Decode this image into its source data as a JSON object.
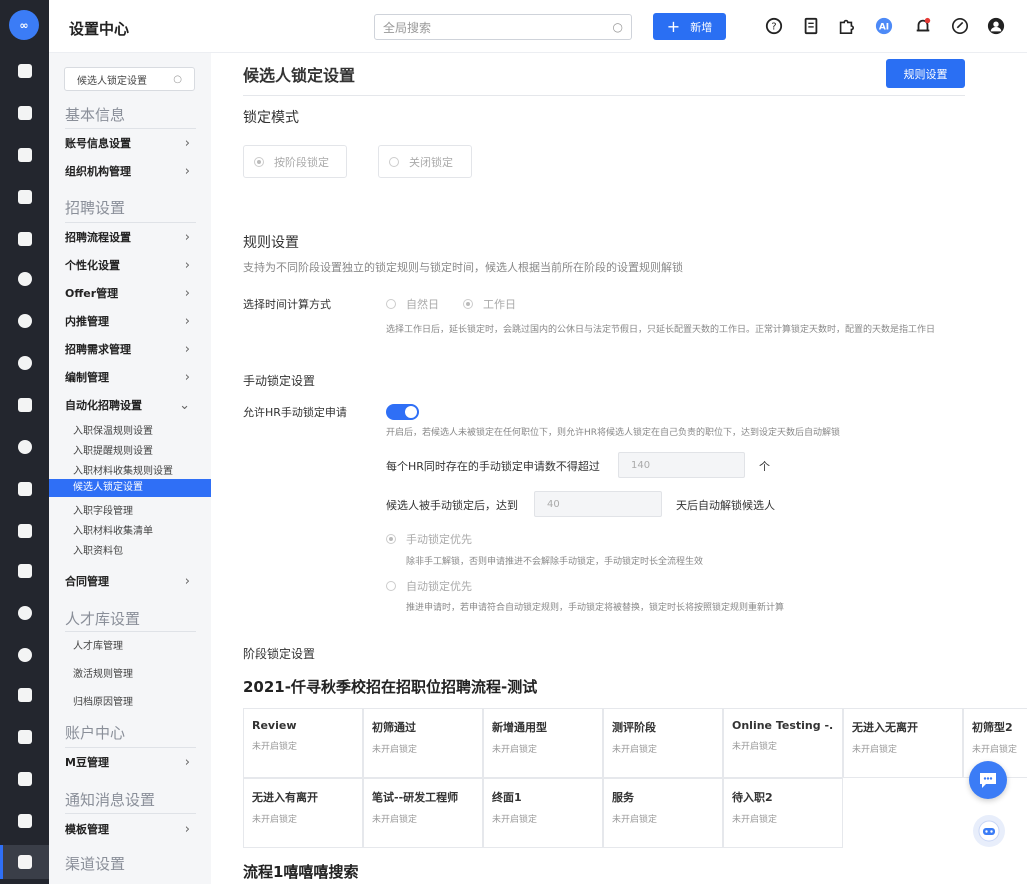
{
  "header": {
    "title": "设置中心",
    "search_placeholder": "全局搜索",
    "add_label": "新增",
    "ai_label": "AI"
  },
  "menu": {
    "search_value": "候选人锁定设置",
    "sections": [
      {
        "title": "基本信息",
        "items": [
          "账号信息设置",
          "组织机构管理"
        ]
      },
      {
        "title": "招聘设置",
        "items": [
          "招聘流程设置",
          "个性化设置",
          "Offer管理",
          "内推管理",
          "招聘需求管理",
          "编制管理",
          "自动化招聘设置"
        ]
      },
      {
        "title": "人才库设置"
      },
      {
        "title": "账户中心",
        "items": [
          "M豆管理"
        ]
      },
      {
        "title": "通知消息设置",
        "items": [
          "模板管理"
        ]
      },
      {
        "title": "渠道设置"
      }
    ],
    "auto_subitems": [
      "入职保温规则设置",
      "入职提醒规则设置",
      "入职材料收集规则设置",
      "候选人锁定设置",
      "入职字段管理",
      "入职材料收集清单",
      "入职资料包"
    ],
    "contract_label": "合同管理",
    "talent_subitems": [
      "人才库管理",
      "激活规则管理",
      "归档原因管理"
    ]
  },
  "main": {
    "page_title": "候选人锁定设置",
    "rule_button": "规则设置",
    "lock_mode": {
      "heading": "锁定模式",
      "options": [
        "按阶段锁定",
        "关闭锁定"
      ]
    },
    "rules": {
      "heading": "规则设置",
      "description": "支持为不同阶段设置独立的锁定规则与锁定时间，候选人根据当前所在阶段的设置规则解锁",
      "time_method_label": "选择时间计算方式",
      "time_options": [
        "自然日",
        "工作日"
      ],
      "time_note": "选择工作日后，延长锁定时，会跳过国内的公休日与法定节假日，只延长配置天数的工作日。正常计算锁定天数时，配置的天数是指工作日",
      "manual_heading": "手动锁定设置",
      "allow_label": "允许HR手动锁定申请",
      "allow_note": "开启后，若候选人未被锁定在任何职位下，则允许HR将候选人锁定在自己负责的职位下，达到设定天数后自动解锁",
      "limit_label": "每个HR同时存在的手动锁定申请数不得超过",
      "limit_value": "140",
      "limit_unit": "个",
      "days_label": "候选人被手动锁定后，达到",
      "days_value": "40",
      "days_suffix": "天后自动解锁候选人",
      "priority_manual": "手动锁定优先",
      "priority_manual_note": "除非手工解锁，否则申请推进不会解除手动锁定，手动锁定时长全流程生效",
      "priority_auto": "自动锁定优先",
      "priority_auto_note": "推进申请时，若申请符合自动锁定规则，手动锁定将被替换，锁定时长将按照锁定规则重新计算"
    },
    "stage": {
      "heading": "阶段锁定设置",
      "flow_title": "2021-仟寻秋季校招在招职位招聘流程-测试",
      "cards_row1": [
        {
          "name": "Review",
          "status": "未开启锁定"
        },
        {
          "name": "初筛通过",
          "status": "未开启锁定"
        },
        {
          "name": "新增通用型",
          "status": "未开启锁定"
        },
        {
          "name": "测评阶段",
          "status": "未开启锁定"
        },
        {
          "name": "Online Testing -...",
          "status": "未开启锁定"
        },
        {
          "name": "无进入无离开",
          "status": "未开启锁定"
        },
        {
          "name": "初筛型2",
          "status": "未开启锁定"
        }
      ],
      "cards_row2": [
        {
          "name": "无进入有离开",
          "status": "未开启锁定"
        },
        {
          "name": "笔试--研发工程师",
          "status": "未开启锁定"
        },
        {
          "name": "终面1",
          "status": "未开启锁定"
        },
        {
          "name": "服务",
          "status": "未开启锁定"
        },
        {
          "name": "待入职2",
          "status": "未开启锁定"
        }
      ],
      "next_flow_title": "流程1嘻嘻嘻搜索"
    }
  },
  "colors": {
    "accent": "#2a6ff3",
    "rail": "#23262e",
    "menu_bg": "#f5f6f8"
  }
}
